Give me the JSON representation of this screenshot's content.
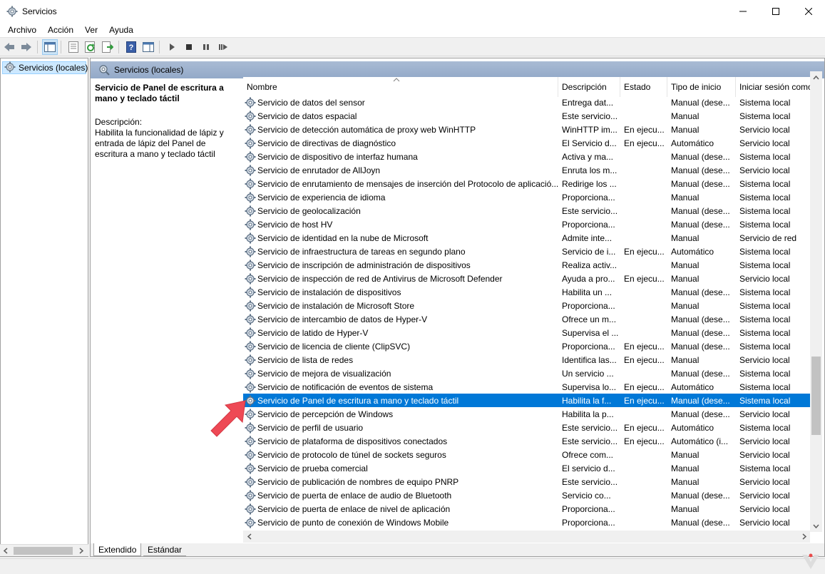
{
  "window": {
    "title": "Servicios"
  },
  "menu": [
    "Archivo",
    "Acción",
    "Ver",
    "Ayuda"
  ],
  "tree": {
    "item": "Servicios (locales)"
  },
  "panel": {
    "header": "Servicios (locales)"
  },
  "description_pane": {
    "title": "Servicio de Panel de escritura a mano y teclado táctil",
    "label": "Descripción:",
    "text": "Habilita la funcionalidad de lápiz y entrada de lápiz del Panel de escritura a mano y teclado táctil"
  },
  "columns": {
    "name": "Nombre",
    "description": "Descripción",
    "state": "Estado",
    "startup": "Tipo de inicio",
    "logon": "Iniciar sesión como"
  },
  "rows": [
    {
      "name": "Servicio de datos del sensor",
      "desc": "Entrega dat...",
      "state": "",
      "type": "Manual (dese...",
      "logon": "Sistema local"
    },
    {
      "name": "Servicio de datos espacial",
      "desc": "Este servicio...",
      "state": "",
      "type": "Manual",
      "logon": "Sistema local"
    },
    {
      "name": "Servicio de detección automática de proxy web WinHTTP",
      "desc": "WinHTTP im...",
      "state": "En ejecu...",
      "type": "Manual",
      "logon": "Servicio local"
    },
    {
      "name": "Servicio de directivas de diagnóstico",
      "desc": "El Servicio d...",
      "state": "En ejecu...",
      "type": "Automático",
      "logon": "Servicio local"
    },
    {
      "name": "Servicio de dispositivo de interfaz humana",
      "desc": "Activa y ma...",
      "state": "",
      "type": "Manual (dese...",
      "logon": "Sistema local"
    },
    {
      "name": "Servicio de enrutador de AllJoyn",
      "desc": "Enruta los m...",
      "state": "",
      "type": "Manual (dese...",
      "logon": "Servicio local"
    },
    {
      "name": "Servicio de enrutamiento de mensajes de inserción del Protocolo de aplicació...",
      "desc": "Redirige los ...",
      "state": "",
      "type": "Manual (dese...",
      "logon": "Sistema local"
    },
    {
      "name": "Servicio de experiencia de idioma",
      "desc": "Proporciona...",
      "state": "",
      "type": "Manual",
      "logon": "Sistema local"
    },
    {
      "name": "Servicio de geolocalización",
      "desc": "Este servicio...",
      "state": "",
      "type": "Manual (dese...",
      "logon": "Sistema local"
    },
    {
      "name": "Servicio de host HV",
      "desc": "Proporciona...",
      "state": "",
      "type": "Manual (dese...",
      "logon": "Sistema local"
    },
    {
      "name": "Servicio de identidad en la nube de Microsoft",
      "desc": "Admite inte...",
      "state": "",
      "type": "Manual",
      "logon": "Servicio de red"
    },
    {
      "name": "Servicio de infraestructura de tareas en segundo plano",
      "desc": "Servicio de i...",
      "state": "En ejecu...",
      "type": "Automático",
      "logon": "Sistema local"
    },
    {
      "name": "Servicio de inscripción de administración de dispositivos",
      "desc": "Realiza activ...",
      "state": "",
      "type": "Manual",
      "logon": "Sistema local"
    },
    {
      "name": "Servicio de inspección de red de Antivirus de Microsoft Defender",
      "desc": "Ayuda a pro...",
      "state": "En ejecu...",
      "type": "Manual",
      "logon": "Servicio local"
    },
    {
      "name": "Servicio de instalación de dispositivos",
      "desc": "Habilita un ...",
      "state": "",
      "type": "Manual (dese...",
      "logon": "Sistema local"
    },
    {
      "name": "Servicio de instalación de Microsoft Store",
      "desc": "Proporciona...",
      "state": "",
      "type": "Manual",
      "logon": "Sistema local"
    },
    {
      "name": "Servicio de intercambio de datos de Hyper-V",
      "desc": "Ofrece un m...",
      "state": "",
      "type": "Manual (dese...",
      "logon": "Sistema local"
    },
    {
      "name": "Servicio de latido de Hyper-V",
      "desc": "Supervisa el ...",
      "state": "",
      "type": "Manual (dese...",
      "logon": "Sistema local"
    },
    {
      "name": "Servicio de licencia de cliente (ClipSVC)",
      "desc": "Proporciona...",
      "state": "En ejecu...",
      "type": "Manual (dese...",
      "logon": "Sistema local"
    },
    {
      "name": "Servicio de lista de redes",
      "desc": "Identifica las...",
      "state": "En ejecu...",
      "type": "Manual",
      "logon": "Servicio local"
    },
    {
      "name": "Servicio de mejora de visualización",
      "desc": "Un servicio ...",
      "state": "",
      "type": "Manual (dese...",
      "logon": "Sistema local"
    },
    {
      "name": "Servicio de notificación de eventos de sistema",
      "desc": "Supervisa lo...",
      "state": "En ejecu...",
      "type": "Automático",
      "logon": "Sistema local"
    },
    {
      "name": "Servicio de Panel de escritura a mano y teclado táctil",
      "desc": "Habilita la f...",
      "state": "En ejecu...",
      "type": "Manual (dese...",
      "logon": "Sistema local",
      "selected": true
    },
    {
      "name": "Servicio de percepción de Windows",
      "desc": "Habilita la p...",
      "state": "",
      "type": "Manual (dese...",
      "logon": "Servicio local"
    },
    {
      "name": "Servicio de perfil de usuario",
      "desc": "Este servicio...",
      "state": "En ejecu...",
      "type": "Automático",
      "logon": "Sistema local"
    },
    {
      "name": "Servicio de plataforma de dispositivos conectados",
      "desc": "Este servicio...",
      "state": "En ejecu...",
      "type": "Automático (i...",
      "logon": "Servicio local"
    },
    {
      "name": "Servicio de protocolo de túnel de sockets seguros",
      "desc": "Ofrece com...",
      "state": "",
      "type": "Manual",
      "logon": "Servicio local"
    },
    {
      "name": "Servicio de prueba comercial",
      "desc": "El servicio d...",
      "state": "",
      "type": "Manual",
      "logon": "Sistema local"
    },
    {
      "name": "Servicio de publicación de nombres de equipo PNRP",
      "desc": "Este servicio...",
      "state": "",
      "type": "Manual",
      "logon": "Servicio local"
    },
    {
      "name": "Servicio de puerta de enlace de audio de Bluetooth",
      "desc": "Servicio co...",
      "state": "",
      "type": "Manual (dese...",
      "logon": "Servicio local"
    },
    {
      "name": "Servicio de puerta de enlace de nivel de aplicación",
      "desc": "Proporciona...",
      "state": "",
      "type": "Manual",
      "logon": "Servicio local"
    },
    {
      "name": "Servicio de punto de conexión de Windows Mobile",
      "desc": "Proporciona...",
      "state": "",
      "type": "Manual (dese...",
      "logon": "Servicio local"
    }
  ],
  "tabs": [
    "Extendido",
    "Estándar"
  ],
  "colors": {
    "selection": "#0078d7",
    "header_band": "#a9bbd4",
    "annotation_arrow": "#ee4955"
  }
}
